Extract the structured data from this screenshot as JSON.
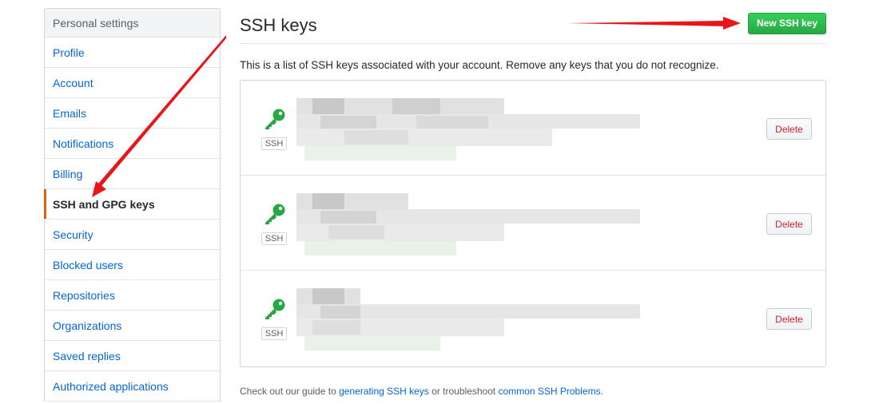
{
  "sidebar": {
    "header": "Personal settings",
    "items": [
      {
        "label": "Profile",
        "selected": false
      },
      {
        "label": "Account",
        "selected": false
      },
      {
        "label": "Emails",
        "selected": false
      },
      {
        "label": "Notifications",
        "selected": false
      },
      {
        "label": "Billing",
        "selected": false
      },
      {
        "label": "SSH and GPG keys",
        "selected": true
      },
      {
        "label": "Security",
        "selected": false
      },
      {
        "label": "Blocked users",
        "selected": false
      },
      {
        "label": "Repositories",
        "selected": false
      },
      {
        "label": "Organizations",
        "selected": false
      },
      {
        "label": "Saved replies",
        "selected": false
      },
      {
        "label": "Authorized applications",
        "selected": false
      }
    ]
  },
  "main": {
    "title": "SSH keys",
    "new_button": "New SSH key",
    "intro": "This is a list of SSH keys associated with your account. Remove any keys that you do not recognize.",
    "keys": [
      {
        "badge": "SSH",
        "delete_label": "Delete",
        "icon": "key-icon",
        "details": "redacted"
      },
      {
        "badge": "SSH",
        "delete_label": "Delete",
        "icon": "key-icon",
        "details": "redacted"
      },
      {
        "badge": "SSH",
        "delete_label": "Delete",
        "icon": "key-icon",
        "details": "redacted"
      }
    ],
    "footer": {
      "text_1": "Check out our guide to ",
      "link_1": "generating SSH keys",
      "text_2": " or troubleshoot ",
      "link_2": "common SSH Problems",
      "text_3": "."
    }
  },
  "colors": {
    "link": "#0366d6",
    "key_icon": "#28a745",
    "primary_button": "#28a745",
    "delete_text": "#cb2431",
    "selected_marker": "#e36209",
    "annotation_arrow": "#e8151b"
  }
}
